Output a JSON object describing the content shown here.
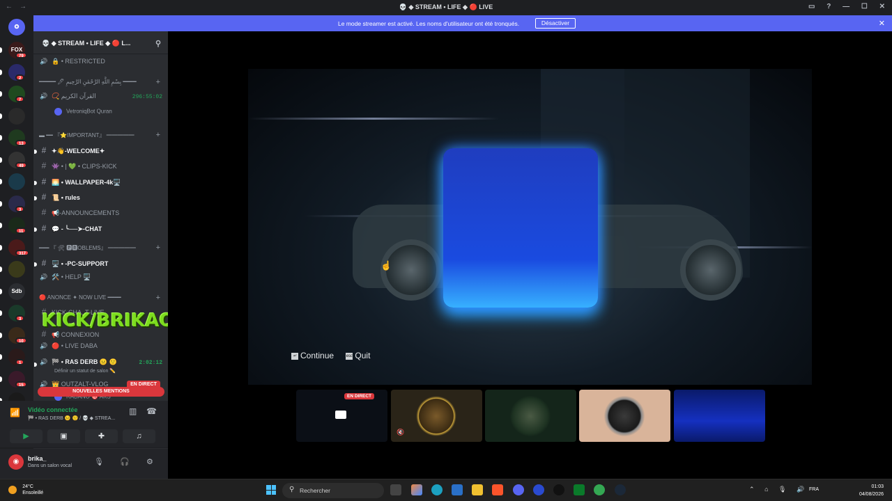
{
  "window": {
    "title": "💀 ◆ STREAM • LIFE ◆ 🔴 LIVE",
    "nav_icons": [
      "back-arrow-icon",
      "forward-arrow-icon"
    ]
  },
  "banner": {
    "text": "Le mode streamer est activé. Les noms d'utilisateur ont été tronqués.",
    "button": "Désactiver"
  },
  "guilds": [
    {
      "label": "FOX",
      "badge": "79"
    },
    {
      "label": "",
      "badge": "2"
    },
    {
      "label": "",
      "badge": "7"
    },
    {
      "label": "",
      "badge": ""
    },
    {
      "label": "",
      "badge": "13"
    },
    {
      "label": "",
      "badge": "49"
    },
    {
      "label": "",
      "badge": ""
    },
    {
      "label": "",
      "badge": "3"
    },
    {
      "label": "",
      "badge": "11"
    },
    {
      "label": "",
      "badge": "317"
    },
    {
      "label": "",
      "badge": ""
    },
    {
      "label": "Sdb",
      "badge": ""
    },
    {
      "label": "",
      "badge": "3"
    },
    {
      "label": "",
      "badge": "10"
    },
    {
      "label": "",
      "badge": "1"
    },
    {
      "label": "",
      "badge": "15"
    },
    {
      "label": "",
      "badge": ""
    }
  ],
  "server": {
    "name": "💀 ◆ STREAM • LIFE ◆ 🔴 L...",
    "channels": [
      {
        "kind": "voice",
        "name": "🔒 • RESTRICTED"
      },
      {
        "kind": "cat",
        "name": "━━━━━ 🖊 بِسْمِ اللَّهِ الرَّحْمَٰنِ الرَّحِيمِ ━━━━"
      },
      {
        "kind": "voice",
        "name": "📿 القرآن الكريم",
        "time": "296:55:02"
      },
      {
        "kind": "user",
        "name": "VetroniqBot Quran"
      },
      {
        "kind": "cat",
        "name": "▬ ━━ 『⭐IMPORTANT』 ━━━━━"
      },
      {
        "kind": "text-bright",
        "name": "✦👋-WELCOME✦"
      },
      {
        "kind": "text",
        "name": "👾 • | 💚 • CLIPS-KICK"
      },
      {
        "kind": "text-bright",
        "name": "🌅 • WALLPAPER-4k🖥️"
      },
      {
        "kind": "text-bright",
        "name": "📜 • rules"
      },
      {
        "kind": "text",
        "name": "📢-ANNOUNCEMENTS"
      },
      {
        "kind": "text-bright",
        "name": "💬 - ╰──➤-CHAT"
      },
      {
        "kind": "cat",
        "name": "━━━ 『 🛠 🅿🆁OBLEMS』 ━━━━━"
      },
      {
        "kind": "text-bright",
        "name": "🖥️ • -PC-SUPPORT"
      },
      {
        "kind": "voice",
        "name": "🛠️ • HELP 🖥️"
      },
      {
        "kind": "cat",
        "name": "🔴 ANONCE ✦ NOW LIVE ━━━━"
      },
      {
        "kind": "text",
        "name": "KICK-CHA..T-LIVE"
      },
      {
        "kind": "text",
        "name": "📢 CONNEXION"
      },
      {
        "kind": "voice",
        "name": "🔴 • LIVE DABA"
      },
      {
        "kind": "voice-bright",
        "name": "🏁 • RAS DERB 😐 🙂",
        "time": "2:02:12"
      },
      {
        "kind": "status",
        "name": "Définir un statut de salon ✏️"
      },
      {
        "kind": "voice",
        "name": "👑 OUTZALT-VLOG"
      },
      {
        "kind": "user",
        "name": "RABANO 🎯 AKS"
      }
    ],
    "live_badge": "EN DIRECT",
    "mentions": "NOUVELLES MENTIONS"
  },
  "overlay_text": "KICK/BRIKAO",
  "voice": {
    "status": "Vidéo connectée",
    "channel": "🏁 • RAS DERB 😐 🙂 / 💀 ◆ STREA..."
  },
  "user": {
    "name": "brika_",
    "status": "Dans un salon vocal"
  },
  "stream": {
    "continue_label": "Continue",
    "quit_label": "Quit",
    "live_badge": "EN DIRECT"
  },
  "tiles": [
    {
      "name": "screen-share",
      "badge": "EN DIRECT"
    },
    {
      "name": "avatar-monkey",
      "badge": ""
    },
    {
      "name": "avatar-babanoz",
      "badge": ""
    },
    {
      "name": "avatar-outzalt",
      "badge": ""
    },
    {
      "name": "avatar-gamer-room",
      "badge": ""
    }
  ],
  "taskbar": {
    "temp": "24°C",
    "weather": "Ensoleillé",
    "search_placeholder": "Rechercher",
    "lang": "FRA",
    "time": "01:03",
    "date": "04/08/2026"
  },
  "colors": {
    "blurple": "#5865f2",
    "live_red": "#da373c",
    "online_green": "#23a55a",
    "overlay_green": "#7ddc1f"
  }
}
